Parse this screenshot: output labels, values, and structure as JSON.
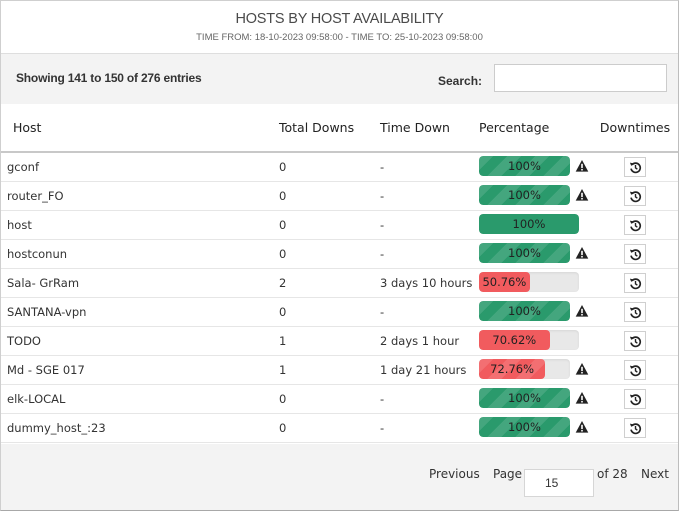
{
  "header": {
    "title": "HOSTS BY HOST AVAILABILITY",
    "subtitle": "TIME FROM: 18-10-2023 09:58:00 - TIME TO: 25-10-2023 09:58:00"
  },
  "toolbar": {
    "showing": "Showing 141 to 150 of 276 entries",
    "search_label": "Search:",
    "search_value": "",
    "search_placeholder": ""
  },
  "table": {
    "columns": [
      "Host",
      "Total Downs",
      "Time Down",
      "Percentage",
      "Downtimes"
    ],
    "rows": [
      {
        "host": "gconf",
        "total_downs": "0",
        "time_down": "-",
        "percentage": 100,
        "percentage_label": "100%",
        "status": "ok",
        "warning": true,
        "downtimes_icon": "history-icon"
      },
      {
        "host": "router_FO",
        "total_downs": "0",
        "time_down": "-",
        "percentage": 100,
        "percentage_label": "100%",
        "status": "ok",
        "warning": true,
        "downtimes_icon": "history-icon"
      },
      {
        "host": "host",
        "total_downs": "0",
        "time_down": "-",
        "percentage": 100,
        "percentage_label": "100%",
        "status": "ok",
        "warning": false,
        "downtimes_icon": "history-icon"
      },
      {
        "host": "hostconun",
        "total_downs": "0",
        "time_down": "-",
        "percentage": 100,
        "percentage_label": "100%",
        "status": "ok",
        "warning": true,
        "downtimes_icon": "history-icon"
      },
      {
        "host": "Sala- GrRam",
        "total_downs": "2",
        "time_down": "3 days 10 hours",
        "percentage": 50.76,
        "percentage_label": "50.76%",
        "status": "down",
        "warning": false,
        "downtimes_icon": "history-icon"
      },
      {
        "host": "SANTANA-vpn",
        "total_downs": "0",
        "time_down": "-",
        "percentage": 100,
        "percentage_label": "100%",
        "status": "ok",
        "warning": true,
        "downtimes_icon": "history-icon"
      },
      {
        "host": "TODO",
        "total_downs": "1",
        "time_down": "2 days 1 hour",
        "percentage": 70.62,
        "percentage_label": "70.62%",
        "status": "down",
        "warning": false,
        "downtimes_icon": "history-icon"
      },
      {
        "host": "Md - SGE 017",
        "total_downs": "1",
        "time_down": "1 day 21 hours",
        "percentage": 72.76,
        "percentage_label": "72.76%",
        "status": "down",
        "warning": true,
        "downtimes_icon": "history-icon"
      },
      {
        "host": "elk-LOCAL",
        "total_downs": "0",
        "time_down": "-",
        "percentage": 100,
        "percentage_label": "100%",
        "status": "ok",
        "warning": true,
        "downtimes_icon": "history-icon"
      },
      {
        "host": "dummy_host_:23",
        "total_downs": "0",
        "time_down": "-",
        "percentage": 100,
        "percentage_label": "100%",
        "status": "ok",
        "warning": true,
        "downtimes_icon": "history-icon"
      }
    ]
  },
  "pagination": {
    "previous_label": "Previous",
    "page_label": "Page",
    "current_page": "15",
    "of_label": "of 28",
    "next_label": "Next"
  },
  "colors": {
    "ok": "#2a9a6c",
    "down": "#f15b5e",
    "track": "#e8e8e8",
    "toolbar_bg": "#f3f3f3"
  }
}
